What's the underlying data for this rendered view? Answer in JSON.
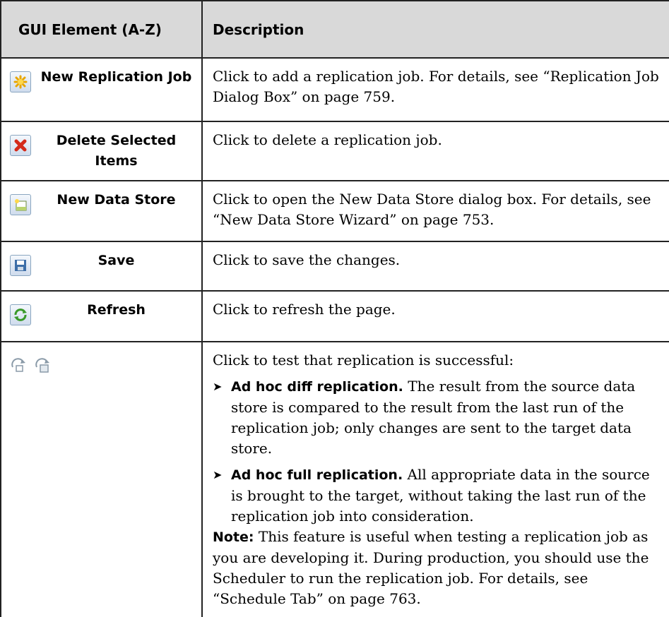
{
  "table": {
    "header": {
      "col1": "GUI Element (A-Z)",
      "col2": "Description"
    },
    "rows": [
      {
        "icon": "new-replication-job-icon",
        "label": "New Replication Job",
        "desc_before": "Click to add a replication job. For details, see “Replication Job Dialog Box” on page 759."
      },
      {
        "icon": "delete-selected-items-icon",
        "label": "Delete Selected Items",
        "desc_before": "Click to delete a replication job."
      },
      {
        "icon": "new-data-store-icon",
        "label": "New Data Store",
        "desc_before": "Click to open the New Data Store dialog box. For details, see “New Data Store Wizard” on page 753."
      },
      {
        "icon": "save-icon",
        "label": "Save",
        "desc_before": "Click to save the changes."
      },
      {
        "icon": "refresh-icon",
        "label": "Refresh",
        "desc_before": "Click to refresh the page."
      },
      {
        "icons": [
          "ad-hoc-diff-replication-icon",
          "ad-hoc-full-replication-icon"
        ],
        "intro": "Click to test that replication is successful:",
        "bullets": [
          {
            "title": "Ad hoc diff replication.",
            "text": " The result from the source data store is compared to the result from the last run of the replication job; only changes are sent to the target data store."
          },
          {
            "title": "Ad hoc full replication.",
            "text": " All appropriate data in the source is brought to the target, without taking the last run of the replication job into consideration."
          }
        ],
        "note_label": "Note:",
        "note_text": " This feature is useful when testing a replication job as you are developing it. During production, you should use the Scheduler to run the replication job. For details, see “Schedule Tab” on page 763."
      }
    ]
  }
}
